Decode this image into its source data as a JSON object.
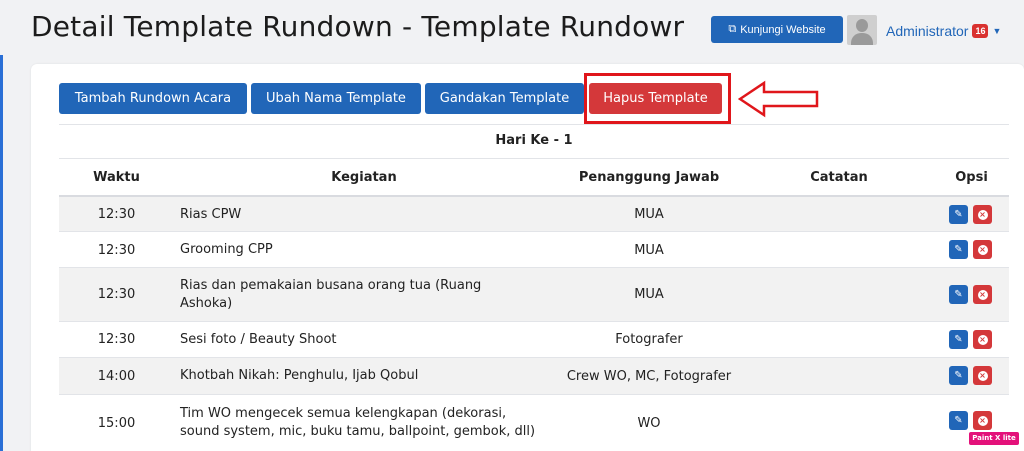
{
  "header": {
    "title": "Detail Template Rundown - Template Rundowr",
    "visit_button": "Kunjungi Website",
    "visit_icon": "external-link-icon",
    "user_name": "Administrator",
    "notification_count": "16"
  },
  "toolbar": {
    "add_label": "Tambah Rundown Acara",
    "rename_label": "Ubah Nama Template",
    "duplicate_label": "Gandakan Template",
    "delete_label": "Hapus Template"
  },
  "colors": {
    "primary": "#2166b8",
    "danger": "#d4383a",
    "highlight": "#e0161b"
  },
  "table": {
    "day_title": "Hari Ke - 1",
    "columns": [
      "Waktu",
      "Kegiatan",
      "Penanggung Jawab",
      "Catatan",
      "Opsi"
    ],
    "rows": [
      {
        "time": "12:30",
        "activity": "Rias CPW",
        "pic": "MUA",
        "notes": ""
      },
      {
        "time": "12:30",
        "activity": "Grooming CPP",
        "pic": "MUA",
        "notes": ""
      },
      {
        "time": "12:30",
        "activity": "Rias dan pemakaian busana orang tua (Ruang Ashoka)",
        "pic": "MUA",
        "notes": ""
      },
      {
        "time": "12:30",
        "activity": "Sesi foto / Beauty Shoot",
        "pic": "Fotografer",
        "notes": ""
      },
      {
        "time": "14:00",
        "activity": "Khotbah Nikah: Penghulu, Ijab Qobul",
        "pic": "Crew WO, MC, Fotografer",
        "notes": ""
      },
      {
        "time": "15:00",
        "activity": "Tim WO mengecek semua kelengkapan (dekorasi, sound system, mic, buku tamu, ballpoint, gembok, dll)",
        "pic": "WO",
        "notes": ""
      }
    ]
  },
  "watermark": "Paint X lite"
}
